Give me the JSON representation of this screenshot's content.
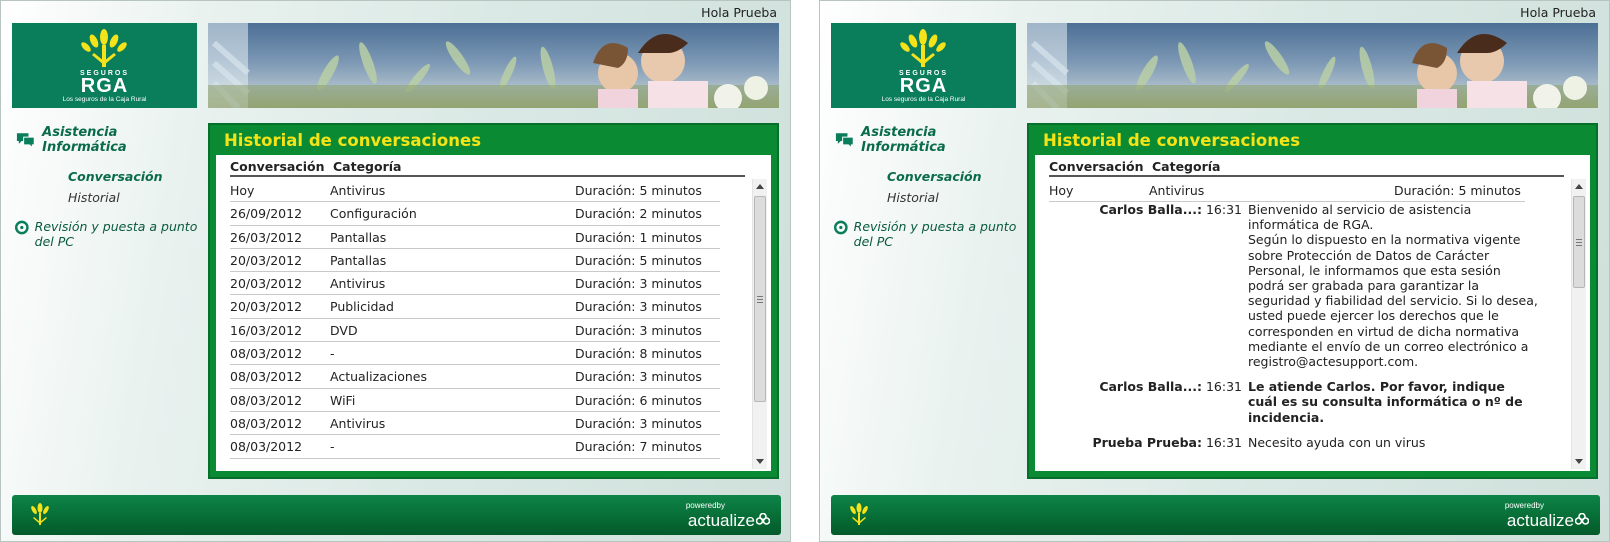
{
  "colors": {
    "brand_green": "#0a7d5a",
    "panel_green": "#0b8a34",
    "title_yellow": "#f3e317",
    "footer_green": "#066b34"
  },
  "header": {
    "greeting": "Hola Prueba"
  },
  "logo": {
    "top": "SEGUROS",
    "brand": "RGA",
    "tagline": "Los seguros de la Caja Rural"
  },
  "sidebar": {
    "section": "Asistencia Informática",
    "sub_active": "Conversación",
    "sub_history": "Historial",
    "revision": "Revisión y puesta a punto del PC",
    "icons": [
      "chat-bubbles-icon",
      "lifebuoy-icon"
    ]
  },
  "panel": {
    "title": "Historial de conversaciones",
    "col_conversation": "Conversación",
    "col_category": "Categoría"
  },
  "history": [
    {
      "date": "Hoy",
      "category": "Antivirus",
      "duration": "Duración: 5 minutos"
    },
    {
      "date": "26/09/2012",
      "category": "Configuración",
      "duration": "Duración: 2 minutos"
    },
    {
      "date": "26/03/2012",
      "category": "Pantallas",
      "duration": "Duración: 1 minutos"
    },
    {
      "date": "20/03/2012",
      "category": "Pantallas",
      "duration": "Duración: 5 minutos"
    },
    {
      "date": "20/03/2012",
      "category": "Antivirus",
      "duration": "Duración: 3 minutos"
    },
    {
      "date": "20/03/2012",
      "category": "Publicidad",
      "duration": "Duración: 3 minutos"
    },
    {
      "date": "16/03/2012",
      "category": "DVD",
      "duration": "Duración: 3 minutos"
    },
    {
      "date": "08/03/2012",
      "category": "-",
      "duration": "Duración: 8 minutos"
    },
    {
      "date": "08/03/2012",
      "category": "Actualizaciones",
      "duration": "Duración: 3 minutos"
    },
    {
      "date": "08/03/2012",
      "category": "WiFi",
      "duration": "Duración: 6 minutos"
    },
    {
      "date": "08/03/2012",
      "category": "Antivirus",
      "duration": "Duración: 3 minutos"
    },
    {
      "date": "08/03/2012",
      "category": "-",
      "duration": "Duración: 7 minutos"
    }
  ],
  "conversation": {
    "date": "Hoy",
    "category": "Antivirus",
    "duration": "Duración: 5 minutos",
    "messages": [
      {
        "author": "Carlos Balla...:",
        "time": "16:31",
        "text": "Bienvenido al servicio de asistencia informática de RGA.\nSegún lo dispuesto en la normativa vigente sobre Protección de Datos de Carácter Personal, le informamos que esta sesión podrá ser grabada para garantizar la seguridad y fiabilidad del servicio. Si lo desea, usted puede ejercer los derechos que le corresponden en virtud de dicha normativa mediante el envío de un correo electrónico a registro@actesupport.com."
      },
      {
        "author": "Carlos Balla...:",
        "time": "16:31",
        "text": "Le atiende Carlos. Por favor, indique cuál es su consulta informática o nº de incidencia."
      },
      {
        "author": "Prueba Prueba:",
        "time": "16:31",
        "text": "Necesito ayuda con un virus"
      }
    ]
  },
  "footer": {
    "powered": "poweredby",
    "vendor": "actualize"
  }
}
